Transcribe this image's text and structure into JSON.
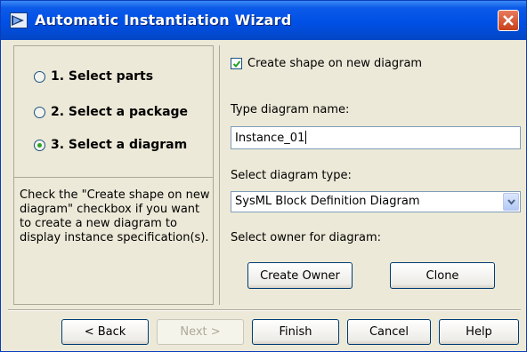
{
  "window": {
    "title": "Automatic Instantiation Wizard",
    "icon": "wizard-icon",
    "close_icon": "close-icon",
    "accent": "#0050e6",
    "close_color": "#c8401b"
  },
  "steps": [
    {
      "label": "1. Select parts",
      "selected": false
    },
    {
      "label": "2. Select a package",
      "selected": false
    },
    {
      "label": "3. Select a diagram",
      "selected": true
    }
  ],
  "help_text": "Check the \"Create shape on new diagram\" checkbox if you want to create a new diagram to display instance specification(s).",
  "form": {
    "create_shape_label": "Create shape on new diagram",
    "create_shape_checked": true,
    "diagram_name_label": "Type diagram name:",
    "diagram_name_value": "Instance_01",
    "diagram_type_label": "Select diagram type:",
    "diagram_type_value": "SysML Block Definition Diagram",
    "owner_label": "Select owner for diagram:",
    "create_owner_button": "Create Owner",
    "clone_button": "Clone"
  },
  "buttons": {
    "back": "< Back",
    "next": "Next >",
    "finish": "Finish",
    "cancel": "Cancel",
    "help": "Help"
  }
}
